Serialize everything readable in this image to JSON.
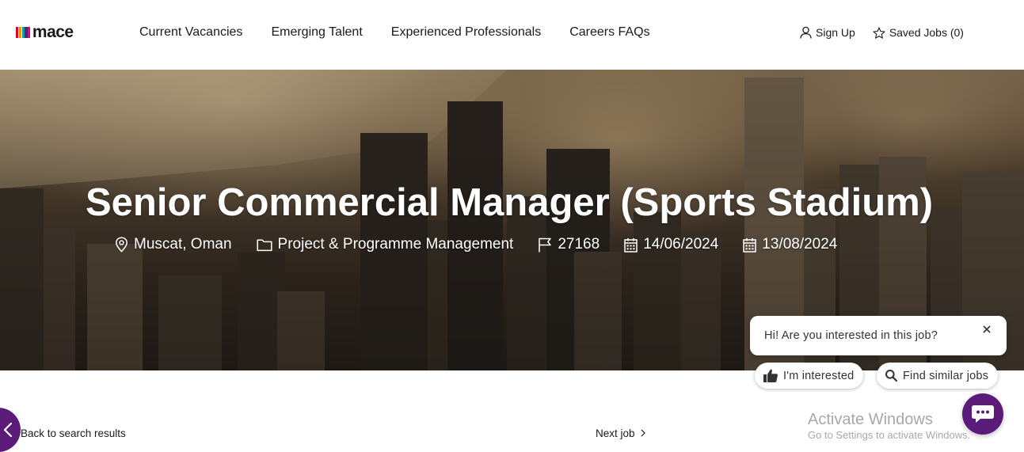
{
  "brand": {
    "name": "mace",
    "stripe_colors": [
      "#e4002b",
      "#f39200",
      "#00a0af",
      "#5a1c78",
      "#e4007c"
    ]
  },
  "nav": {
    "links": [
      "Current Vacancies",
      "Emerging Talent",
      "Experienced Professionals",
      "Careers FAQs"
    ]
  },
  "account": {
    "sign_up": "Sign Up",
    "saved_jobs": "Saved Jobs (0)"
  },
  "job": {
    "title": "Senior Commercial Manager (Sports Stadium)",
    "location": "Muscat, Oman",
    "category": "Project & Programme Management",
    "reference": "27168",
    "posted_date": "14/06/2024",
    "closing_date": "13/08/2024"
  },
  "chatbot": {
    "prompt": "Hi! Are you interested in this job?",
    "interested_label": "I'm interested",
    "similar_label": "Find similar jobs",
    "accent": "#5a1c78"
  },
  "pagination": {
    "back_label": "Back to search results",
    "next_label": "Next job"
  },
  "os_watermark": {
    "title": "Activate Windows",
    "subtitle": "Go to Settings to activate Windows."
  },
  "icons": {
    "location": "map-pin-icon",
    "category": "folder-icon",
    "reference": "flag-icon",
    "dates": "calendar-icon",
    "sign_up": "user-icon",
    "saved": "star-icon"
  }
}
